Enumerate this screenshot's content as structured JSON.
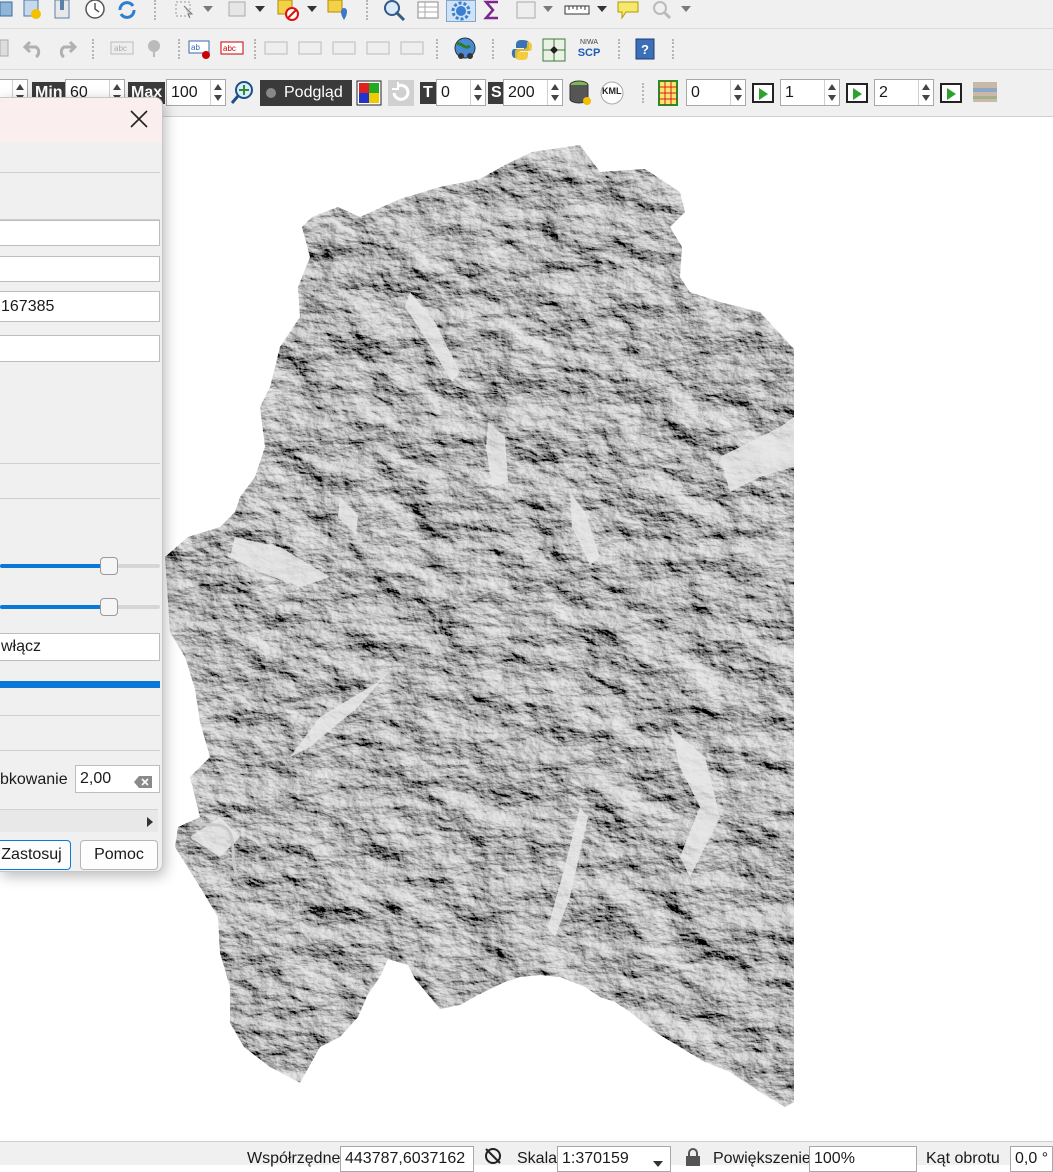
{
  "toolbar3": {
    "min_label": "Min",
    "min_value": "60",
    "max_label": "Max",
    "max_value": "100",
    "preview_label": "Podgląd",
    "t_label": "T",
    "t_value": "0",
    "s_label": "S",
    "s_value": "200",
    "kml_label": "KML",
    "spin_a": "0",
    "spin_b": "1",
    "spin_c": "2"
  },
  "toolbar2": {
    "niwa_label": "NIWA",
    "scp_label": "SCP"
  },
  "dialog": {
    "field_value": "167385",
    "dropdown_value": "włącz",
    "smoothing_label": "bkowanie",
    "smoothing_value": "2,00",
    "apply_button": "Zastosuj",
    "help_button": "Pomoc",
    "slider1_value": 0.68,
    "slider2_value": 0.68
  },
  "statusbar": {
    "coords_label": "Współrzędne",
    "coords_value": "443787,6037162",
    "scale_label": "Skala",
    "scale_value": "1:370159",
    "zoom_label": "Powiększenie",
    "zoom_value": "100%",
    "rotation_label": "Kąt obrotu",
    "rotation_value": "0,0 °"
  },
  "colors": {
    "accent": "#0a78d7",
    "toolbar_bg": "#f0f0f0",
    "dialog_title_bg": "#fbeeee"
  }
}
